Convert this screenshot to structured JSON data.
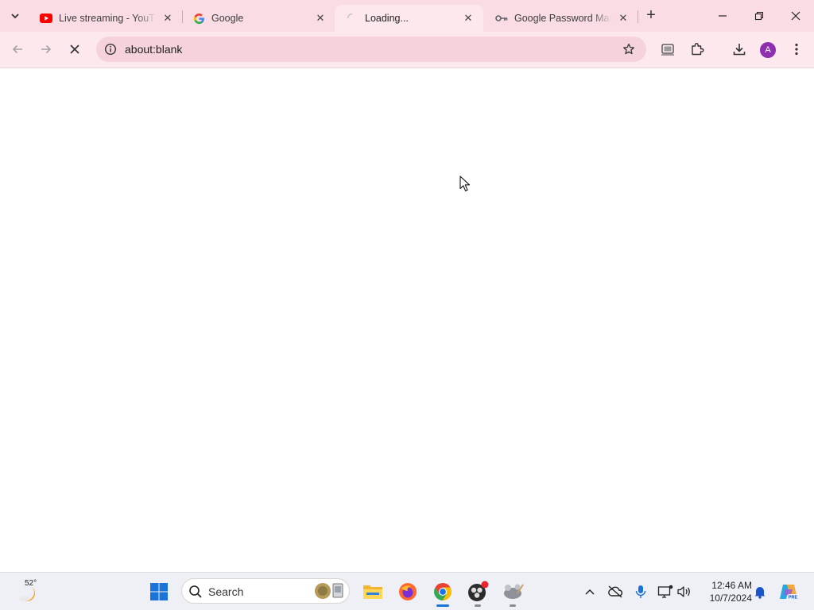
{
  "browser": {
    "tabs": [
      {
        "title": "Live streaming - YouTube",
        "favicon": "youtube-icon",
        "active": false
      },
      {
        "title": "Google",
        "favicon": "google-icon",
        "active": false
      },
      {
        "title": "Loading...",
        "favicon": "loading-spinner-icon",
        "active": true
      },
      {
        "title": "Google Password Manager",
        "favicon": "password-key-icon",
        "active": false
      }
    ],
    "new_tab_label": "+",
    "close_label": "✕",
    "address_bar": {
      "url": "about:blank"
    },
    "profile_initial": "A",
    "colors": {
      "frame": "#f9dce4",
      "toolbar": "#fde8ee",
      "omnibox": "#f6d3dc",
      "avatar": "#8e2fb0"
    }
  },
  "taskbar": {
    "weather_temp": "52°",
    "search_label": "Search",
    "clock_time": "12:46 AM",
    "clock_date": "10/7/2024",
    "apps": [
      "windows-start-icon",
      "file-explorer-icon",
      "firefox-icon",
      "chrome-icon",
      "obs-icon",
      "gimp-icon"
    ],
    "tray": [
      "chevron-up-icon",
      "onedrive-offline-icon",
      "microphone-icon",
      "network-icon",
      "volume-icon",
      "notification-bell-icon",
      "copilot-icon"
    ]
  }
}
